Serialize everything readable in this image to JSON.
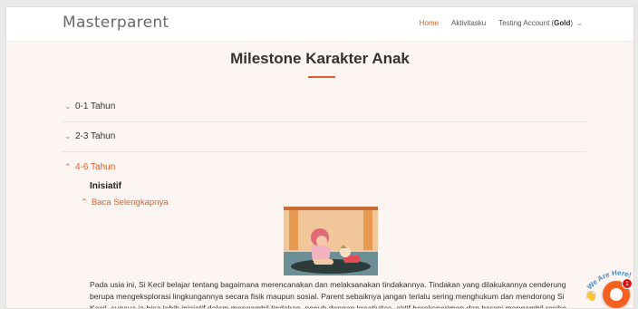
{
  "header": {
    "brand": "Masterparent",
    "nav": {
      "home": "Home",
      "activities": "Aktivitasku",
      "account_prefix": "Testing Account (",
      "account_tier": "Gold",
      "account_suffix": ")"
    }
  },
  "main": {
    "title": "Milestone Karakter Anak",
    "accordion": [
      {
        "label": "0-1 Tahun",
        "open": false
      },
      {
        "label": "2-3 Tahun",
        "open": false
      },
      {
        "label": "4-6 Tahun",
        "open": true
      }
    ],
    "section": {
      "heading": "Inisiatif",
      "read_more": "Baca Selengkapnya",
      "paragraph": "Pada usia ini, Si Kecil belajar tentang bagaimana merencanakan dan melaksanakan tindakannya. Tindakan yang dilakukannya cenderung berupa mengeksplorasi lingkungannya secara fisik maupun sosial. Parent sebaiknya jangan terlalu sering menghukum dan mendorong Si Kecil, supaya ia bisa lebih inisiatif dalam mengambil tindakan, penuh dengan kreativitas, aktif bereksperimen dan berani mengambil resiko"
    }
  },
  "chat_widget": {
    "label": "We Are Here!",
    "notification_count": "1",
    "accent": "#f5601f"
  },
  "colors": {
    "accent": "#e0602b",
    "background": "#fdf5f1"
  }
}
